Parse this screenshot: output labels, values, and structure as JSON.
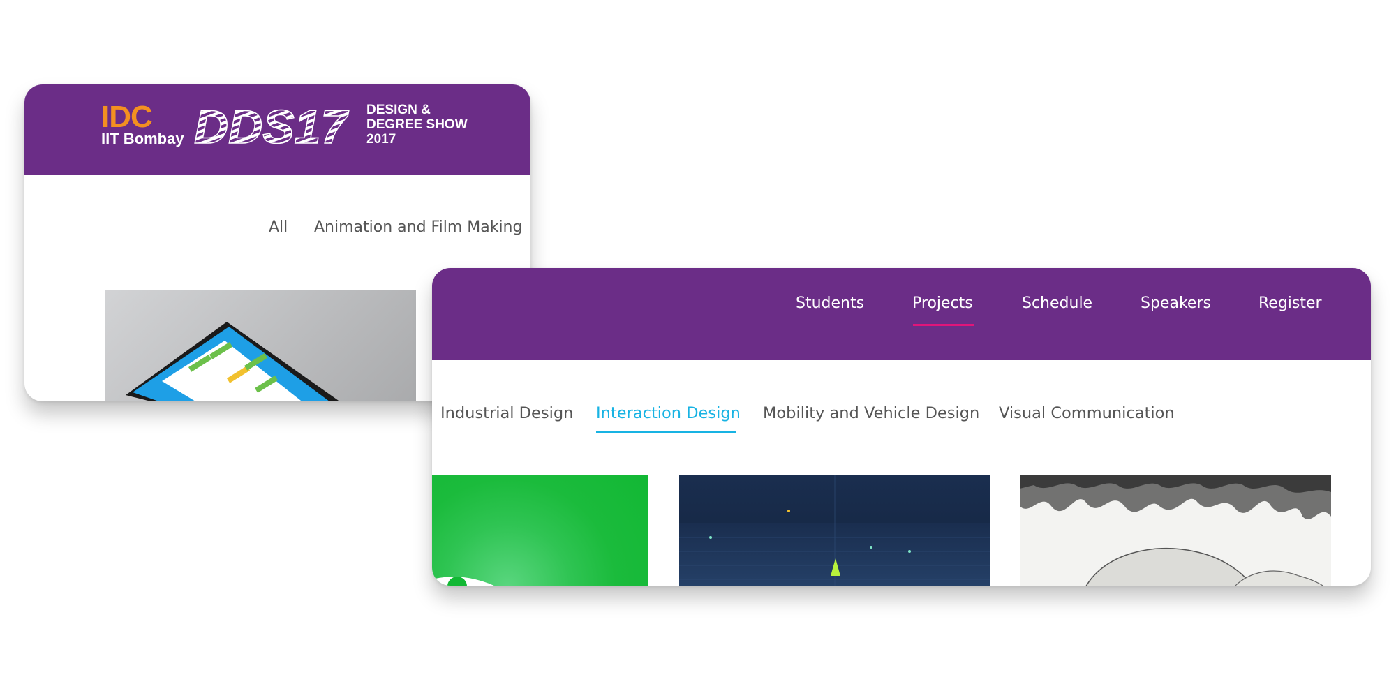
{
  "back_card": {
    "brand": {
      "org": "IDC",
      "institute": "IIT Bombay",
      "logo_text": "DDS17",
      "event_lines": [
        "DESIGN &",
        "DEGREE SHOW",
        "2017"
      ]
    },
    "filters": [
      "All",
      "Animation and Film Making"
    ]
  },
  "front_card": {
    "nav": [
      "Students",
      "Projects",
      "Schedule",
      "Speakers",
      "Register"
    ],
    "nav_active": "Projects",
    "categories": [
      "Industrial Design",
      "Interaction Design",
      "Mobility and Vehicle Design",
      "Visual Communication"
    ],
    "category_active": "Interaction Design"
  },
  "colors": {
    "header_purple": "#6b2d87",
    "brand_orange": "#f39021",
    "nav_active_underline": "#e0157a",
    "category_active": "#18b3e3"
  },
  "icons": [
    "thumbnail-tablet-app",
    "thumbnail-green-chat",
    "thumbnail-dark-3d-grid",
    "thumbnail-ink-landscape"
  ]
}
